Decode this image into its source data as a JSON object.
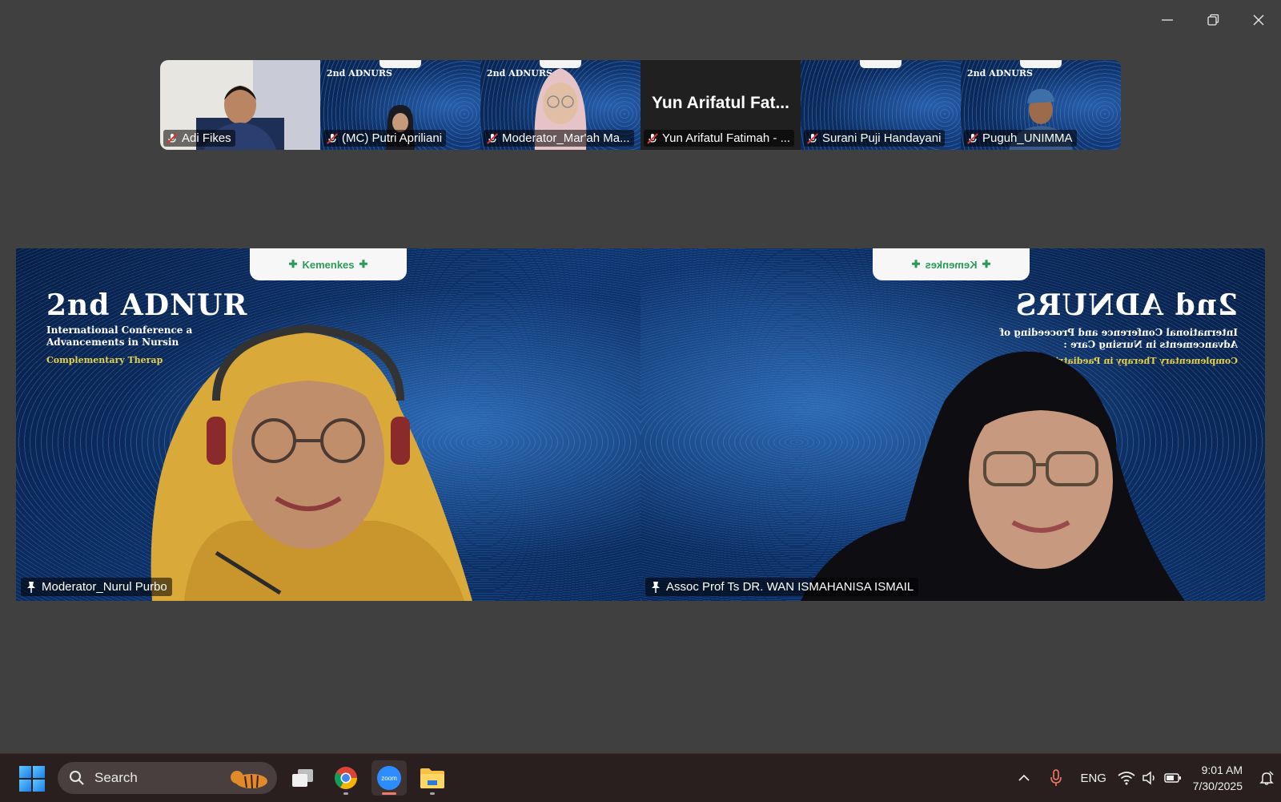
{
  "window": {
    "minimize": "minimize",
    "restore": "restore",
    "close": "close"
  },
  "thumbnails": [
    {
      "name": "Adi Fikes",
      "muted": true
    },
    {
      "name": "(MC) Putri Apriliani",
      "muted": true
    },
    {
      "name": "Moderator_Mar'ah Ma...",
      "muted": true
    },
    {
      "name": "Yun Arifatul Fatimah - ...",
      "muted": true,
      "display_name": "Yun Arifatul Fat..."
    },
    {
      "name": "Surani Puji Handayani",
      "muted": true
    },
    {
      "name": "Puguh_UNIMMA",
      "muted": true
    }
  ],
  "slide": {
    "title": "2nd ADNURS",
    "subtitle_line1": "International Conference and Proceeding of",
    "subtitle_line2": "Advancements in Nursing Care :",
    "theme": "Complementary Therapy in Paediatric Nursing",
    "logo_text": "Kemenkes"
  },
  "left_title": "2nd ADNUR",
  "left_sub1": "International Conference a",
  "left_sub2": "Advancements in Nursin",
  "left_theme": "Complementary Therap",
  "main_tiles": [
    {
      "name": "Moderator_Nurul Purbo",
      "pinned": true
    },
    {
      "name": "Assoc Prof Ts DR. WAN ISMAHANISA ISMAIL",
      "pinned": true,
      "active_speaker": true
    }
  ],
  "taskbar": {
    "search_placeholder": "Search",
    "apps": [
      "task-view",
      "chrome",
      "zoom",
      "file-explorer"
    ],
    "zoom_label": "zoom",
    "language": "ENG",
    "time": "9:01 AM",
    "date": "7/30/2025"
  },
  "colors": {
    "active_speaker_border": "#2bd99a",
    "taskbar_bg": "#2a1f1f",
    "stage_bg": "#404040"
  }
}
